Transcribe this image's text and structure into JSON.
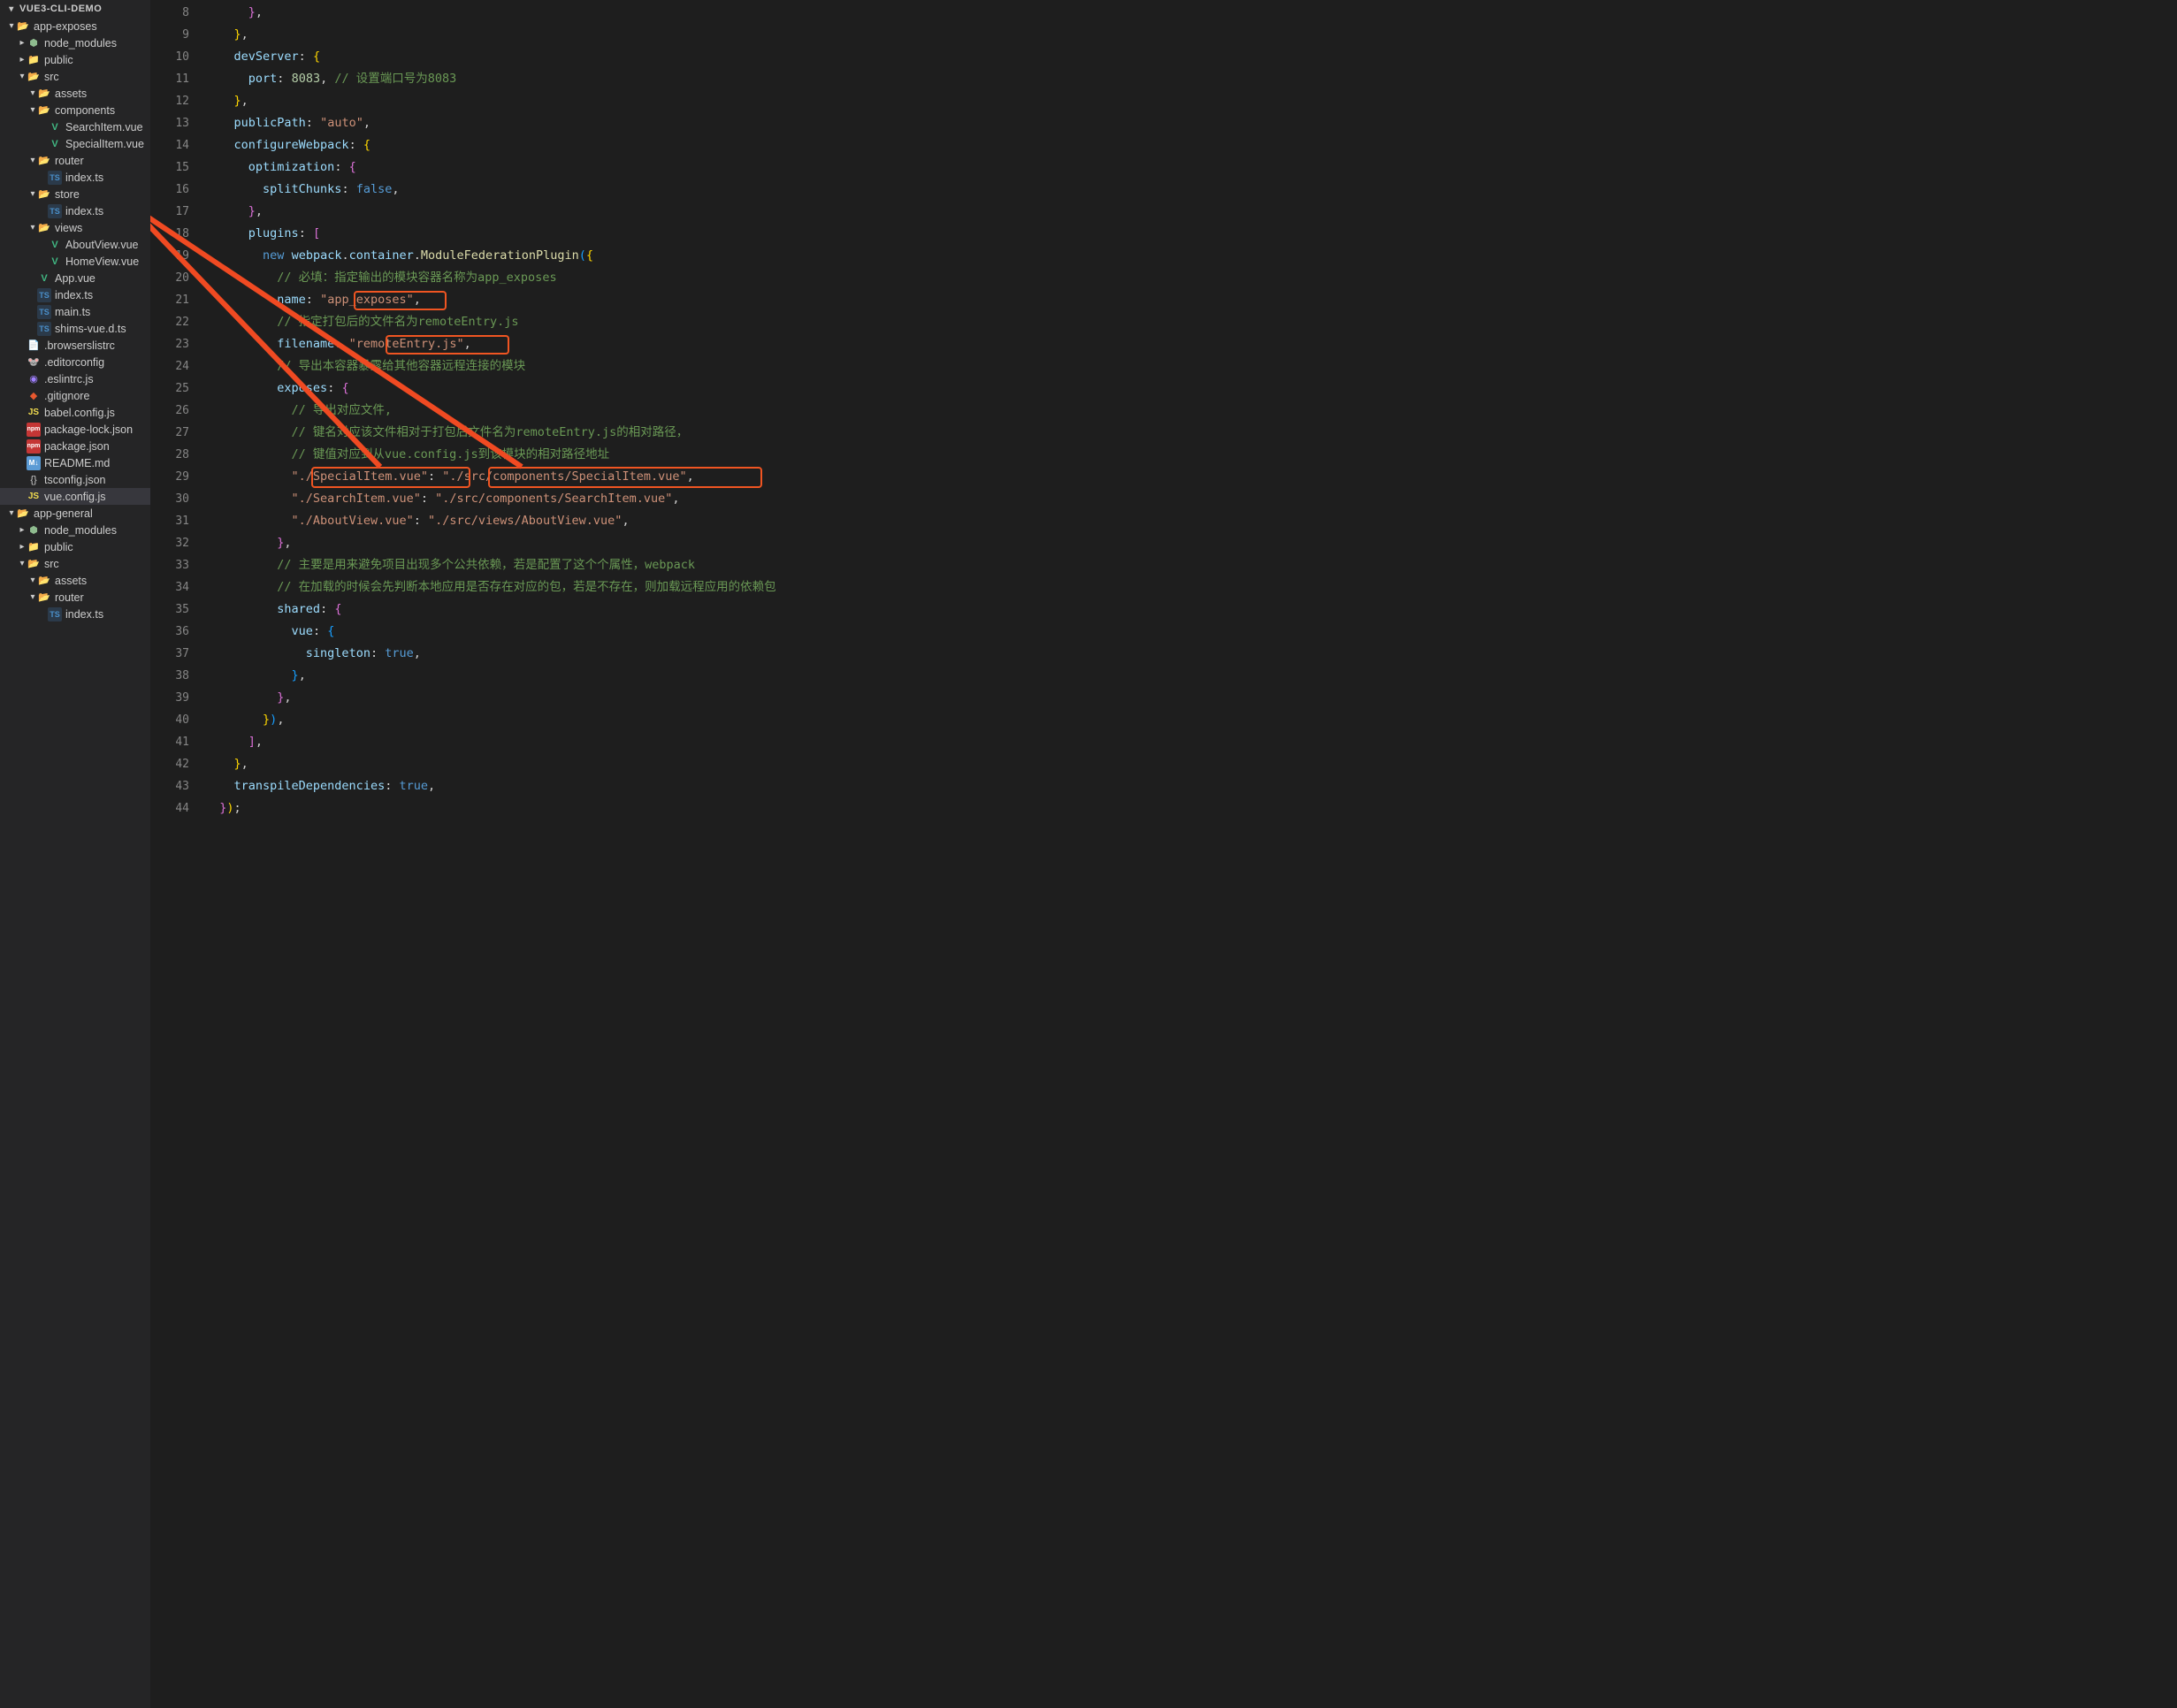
{
  "explorer": {
    "title": "VUE3-CLI-DEMO",
    "tree": [
      {
        "indent": 1,
        "chev": "▾",
        "icon": "folder-open",
        "label": "app-exposes"
      },
      {
        "indent": 2,
        "chev": "▸",
        "icon": "node",
        "label": "node_modules"
      },
      {
        "indent": 2,
        "chev": "▸",
        "icon": "folder",
        "label": "public"
      },
      {
        "indent": 2,
        "chev": "▾",
        "icon": "folder-open",
        "label": "src"
      },
      {
        "indent": 3,
        "chev": "▾",
        "icon": "folder-open",
        "label": "assets"
      },
      {
        "indent": 3,
        "chev": "▾",
        "icon": "folder-open",
        "label": "components"
      },
      {
        "indent": 4,
        "chev": "",
        "icon": "vue",
        "label": "SearchItem.vue"
      },
      {
        "indent": 4,
        "chev": "",
        "icon": "vue",
        "label": "SpecialItem.vue"
      },
      {
        "indent": 3,
        "chev": "▾",
        "icon": "folder-open",
        "label": "router"
      },
      {
        "indent": 4,
        "chev": "",
        "icon": "ts",
        "label": "index.ts"
      },
      {
        "indent": 3,
        "chev": "▾",
        "icon": "folder-open",
        "label": "store"
      },
      {
        "indent": 4,
        "chev": "",
        "icon": "ts",
        "label": "index.ts"
      },
      {
        "indent": 3,
        "chev": "▾",
        "icon": "folder-open",
        "label": "views"
      },
      {
        "indent": 4,
        "chev": "",
        "icon": "vue",
        "label": "AboutView.vue"
      },
      {
        "indent": 4,
        "chev": "",
        "icon": "vue",
        "label": "HomeView.vue"
      },
      {
        "indent": 3,
        "chev": "",
        "icon": "vue",
        "label": "App.vue"
      },
      {
        "indent": 3,
        "chev": "",
        "icon": "ts",
        "label": "index.ts"
      },
      {
        "indent": 3,
        "chev": "",
        "icon": "ts",
        "label": "main.ts"
      },
      {
        "indent": 3,
        "chev": "",
        "icon": "ts",
        "label": "shims-vue.d.ts"
      },
      {
        "indent": 2,
        "chev": "",
        "icon": "browsers",
        "label": ".browserslistrc"
      },
      {
        "indent": 2,
        "chev": "",
        "icon": "editor",
        "label": ".editorconfig"
      },
      {
        "indent": 2,
        "chev": "",
        "icon": "eslint",
        "label": ".eslintrc.js"
      },
      {
        "indent": 2,
        "chev": "",
        "icon": "git",
        "label": ".gitignore"
      },
      {
        "indent": 2,
        "chev": "",
        "icon": "js",
        "label": "babel.config.js"
      },
      {
        "indent": 2,
        "chev": "",
        "icon": "npm",
        "label": "package-lock.json"
      },
      {
        "indent": 2,
        "chev": "",
        "icon": "npm",
        "label": "package.json"
      },
      {
        "indent": 2,
        "chev": "",
        "icon": "md",
        "label": "README.md"
      },
      {
        "indent": 2,
        "chev": "",
        "icon": "json",
        "label": "tsconfig.json"
      },
      {
        "indent": 2,
        "chev": "",
        "icon": "js",
        "label": "vue.config.js",
        "selected": true
      },
      {
        "indent": 1,
        "chev": "▾",
        "icon": "folder-open",
        "label": "app-general"
      },
      {
        "indent": 2,
        "chev": "▸",
        "icon": "node",
        "label": "node_modules"
      },
      {
        "indent": 2,
        "chev": "▸",
        "icon": "folder",
        "label": "public"
      },
      {
        "indent": 2,
        "chev": "▾",
        "icon": "folder-open",
        "label": "src"
      },
      {
        "indent": 3,
        "chev": "▾",
        "icon": "folder-open",
        "label": "assets"
      },
      {
        "indent": 3,
        "chev": "▾",
        "icon": "folder-open",
        "label": "router"
      },
      {
        "indent": 4,
        "chev": "",
        "icon": "ts",
        "label": "index.ts"
      }
    ]
  },
  "editor": {
    "startLine": 8,
    "endLine": 44,
    "lines": [
      {
        "n": 8,
        "tokens": [
          {
            "t": "      ",
            "c": ""
          },
          {
            "t": "}",
            "c": "brace2"
          },
          {
            "t": ",",
            "c": "punc"
          }
        ]
      },
      {
        "n": 9,
        "tokens": [
          {
            "t": "    ",
            "c": ""
          },
          {
            "t": "}",
            "c": "brace"
          },
          {
            "t": ",",
            "c": "punc"
          }
        ]
      },
      {
        "n": 10,
        "tokens": [
          {
            "t": "    ",
            "c": ""
          },
          {
            "t": "devServer",
            "c": "key"
          },
          {
            "t": ": ",
            "c": "punc"
          },
          {
            "t": "{",
            "c": "brace"
          }
        ]
      },
      {
        "n": 11,
        "tokens": [
          {
            "t": "      ",
            "c": ""
          },
          {
            "t": "port",
            "c": "key"
          },
          {
            "t": ": ",
            "c": "punc"
          },
          {
            "t": "8083",
            "c": "num"
          },
          {
            "t": ", ",
            "c": "punc"
          },
          {
            "t": "// 设置端口号为8083",
            "c": "comment"
          }
        ]
      },
      {
        "n": 12,
        "tokens": [
          {
            "t": "    ",
            "c": ""
          },
          {
            "t": "}",
            "c": "brace"
          },
          {
            "t": ",",
            "c": "punc"
          }
        ]
      },
      {
        "n": 13,
        "tokens": [
          {
            "t": "    ",
            "c": ""
          },
          {
            "t": "publicPath",
            "c": "key"
          },
          {
            "t": ": ",
            "c": "punc"
          },
          {
            "t": "\"auto\"",
            "c": "str"
          },
          {
            "t": ",",
            "c": "punc"
          }
        ]
      },
      {
        "n": 14,
        "tokens": [
          {
            "t": "    ",
            "c": ""
          },
          {
            "t": "configureWebpack",
            "c": "key"
          },
          {
            "t": ": ",
            "c": "punc"
          },
          {
            "t": "{",
            "c": "brace"
          }
        ]
      },
      {
        "n": 15,
        "tokens": [
          {
            "t": "      ",
            "c": ""
          },
          {
            "t": "optimization",
            "c": "key"
          },
          {
            "t": ": ",
            "c": "punc"
          },
          {
            "t": "{",
            "c": "brace2"
          }
        ]
      },
      {
        "n": 16,
        "tokens": [
          {
            "t": "        ",
            "c": ""
          },
          {
            "t": "splitChunks",
            "c": "key"
          },
          {
            "t": ": ",
            "c": "punc"
          },
          {
            "t": "false",
            "c": "bool"
          },
          {
            "t": ",",
            "c": "punc"
          }
        ]
      },
      {
        "n": 17,
        "tokens": [
          {
            "t": "      ",
            "c": ""
          },
          {
            "t": "}",
            "c": "brace2"
          },
          {
            "t": ",",
            "c": "punc"
          }
        ]
      },
      {
        "n": 18,
        "tokens": [
          {
            "t": "      ",
            "c": ""
          },
          {
            "t": "plugins",
            "c": "key"
          },
          {
            "t": ": ",
            "c": "punc"
          },
          {
            "t": "[",
            "c": "brace2"
          }
        ]
      },
      {
        "n": 19,
        "tokens": [
          {
            "t": "        ",
            "c": ""
          },
          {
            "t": "new",
            "c": "kw"
          },
          {
            "t": " ",
            "c": ""
          },
          {
            "t": "webpack",
            "c": "var"
          },
          {
            "t": ".",
            "c": "punc"
          },
          {
            "t": "container",
            "c": "var"
          },
          {
            "t": ".",
            "c": "punc"
          },
          {
            "t": "ModuleFederationPlugin",
            "c": "func"
          },
          {
            "t": "(",
            "c": "brace3"
          },
          {
            "t": "{",
            "c": "brace"
          }
        ]
      },
      {
        "n": 20,
        "tokens": [
          {
            "t": "          ",
            "c": ""
          },
          {
            "t": "// 必填：指定输出的模块容器名称为app_exposes",
            "c": "comment"
          }
        ]
      },
      {
        "n": 21,
        "tokens": [
          {
            "t": "          ",
            "c": ""
          },
          {
            "t": "name",
            "c": "key"
          },
          {
            "t": ": ",
            "c": "punc"
          },
          {
            "t": "\"app_exposes\"",
            "c": "str"
          },
          {
            "t": ",",
            "c": "punc"
          }
        ]
      },
      {
        "n": 22,
        "tokens": [
          {
            "t": "          ",
            "c": ""
          },
          {
            "t": "// 指定打包后的文件名为remoteEntry.js",
            "c": "comment"
          }
        ]
      },
      {
        "n": 23,
        "tokens": [
          {
            "t": "          ",
            "c": ""
          },
          {
            "t": "filename",
            "c": "key"
          },
          {
            "t": ": ",
            "c": "punc"
          },
          {
            "t": "\"remoteEntry.js\"",
            "c": "str"
          },
          {
            "t": ",",
            "c": "punc"
          }
        ]
      },
      {
        "n": 24,
        "tokens": [
          {
            "t": "          ",
            "c": ""
          },
          {
            "t": "// 导出本容器暴露给其他容器远程连接的模块",
            "c": "comment"
          }
        ]
      },
      {
        "n": 25,
        "tokens": [
          {
            "t": "          ",
            "c": ""
          },
          {
            "t": "exposes",
            "c": "key"
          },
          {
            "t": ": ",
            "c": "punc"
          },
          {
            "t": "{",
            "c": "brace2"
          }
        ]
      },
      {
        "n": 26,
        "tokens": [
          {
            "t": "            ",
            "c": ""
          },
          {
            "t": "// 导出对应文件,",
            "c": "comment"
          }
        ]
      },
      {
        "n": 27,
        "tokens": [
          {
            "t": "            ",
            "c": ""
          },
          {
            "t": "// 键名对应该文件相对于打包后文件名为remoteEntry.js的相对路径，",
            "c": "comment"
          }
        ]
      },
      {
        "n": 28,
        "tokens": [
          {
            "t": "            ",
            "c": ""
          },
          {
            "t": "// 键值对应到从vue.config.js到该模块的相对路径地址",
            "c": "comment"
          }
        ]
      },
      {
        "n": 29,
        "tokens": [
          {
            "t": "            ",
            "c": ""
          },
          {
            "t": "\"./SpecialItem.vue\"",
            "c": "str"
          },
          {
            "t": ": ",
            "c": "punc"
          },
          {
            "t": "\"./src/components/SpecialItem.vue\"",
            "c": "str"
          },
          {
            "t": ",",
            "c": "punc"
          }
        ]
      },
      {
        "n": 30,
        "tokens": [
          {
            "t": "            ",
            "c": ""
          },
          {
            "t": "\"./SearchItem.vue\"",
            "c": "str"
          },
          {
            "t": ": ",
            "c": "punc"
          },
          {
            "t": "\"./src/components/SearchItem.vue\"",
            "c": "str"
          },
          {
            "t": ",",
            "c": "punc"
          }
        ]
      },
      {
        "n": 31,
        "tokens": [
          {
            "t": "            ",
            "c": ""
          },
          {
            "t": "\"./AboutView.vue\"",
            "c": "str"
          },
          {
            "t": ": ",
            "c": "punc"
          },
          {
            "t": "\"./src/views/AboutView.vue\"",
            "c": "str"
          },
          {
            "t": ",",
            "c": "punc"
          }
        ]
      },
      {
        "n": 32,
        "tokens": [
          {
            "t": "          ",
            "c": ""
          },
          {
            "t": "}",
            "c": "brace2"
          },
          {
            "t": ",",
            "c": "punc"
          }
        ]
      },
      {
        "n": 33,
        "tokens": [
          {
            "t": "          ",
            "c": ""
          },
          {
            "t": "// 主要是用来避免项目出现多个公共依赖，若是配置了这个个属性，webpack",
            "c": "comment"
          }
        ]
      },
      {
        "n": 34,
        "tokens": [
          {
            "t": "          ",
            "c": ""
          },
          {
            "t": "// 在加载的时候会先判断本地应用是否存在对应的包，若是不存在，则加载远程应用的依赖包",
            "c": "comment"
          }
        ]
      },
      {
        "n": 35,
        "tokens": [
          {
            "t": "          ",
            "c": ""
          },
          {
            "t": "shared",
            "c": "key"
          },
          {
            "t": ": ",
            "c": "punc"
          },
          {
            "t": "{",
            "c": "brace2"
          }
        ]
      },
      {
        "n": 36,
        "tokens": [
          {
            "t": "            ",
            "c": ""
          },
          {
            "t": "vue",
            "c": "key"
          },
          {
            "t": ": ",
            "c": "punc"
          },
          {
            "t": "{",
            "c": "brace3"
          }
        ]
      },
      {
        "n": 37,
        "tokens": [
          {
            "t": "              ",
            "c": ""
          },
          {
            "t": "singleton",
            "c": "key"
          },
          {
            "t": ": ",
            "c": "punc"
          },
          {
            "t": "true",
            "c": "bool"
          },
          {
            "t": ",",
            "c": "punc"
          }
        ]
      },
      {
        "n": 38,
        "tokens": [
          {
            "t": "            ",
            "c": ""
          },
          {
            "t": "}",
            "c": "brace3"
          },
          {
            "t": ",",
            "c": "punc"
          }
        ]
      },
      {
        "n": 39,
        "tokens": [
          {
            "t": "          ",
            "c": ""
          },
          {
            "t": "}",
            "c": "brace2"
          },
          {
            "t": ",",
            "c": "punc"
          }
        ]
      },
      {
        "n": 40,
        "tokens": [
          {
            "t": "        ",
            "c": ""
          },
          {
            "t": "}",
            "c": "brace"
          },
          {
            "t": ")",
            "c": "brace3"
          },
          {
            "t": ",",
            "c": "punc"
          }
        ]
      },
      {
        "n": 41,
        "tokens": [
          {
            "t": "      ",
            "c": ""
          },
          {
            "t": "]",
            "c": "brace2"
          },
          {
            "t": ",",
            "c": "punc"
          }
        ]
      },
      {
        "n": 42,
        "tokens": [
          {
            "t": "    ",
            "c": ""
          },
          {
            "t": "}",
            "c": "brace"
          },
          {
            "t": ",",
            "c": "punc"
          }
        ]
      },
      {
        "n": 43,
        "tokens": [
          {
            "t": "    ",
            "c": ""
          },
          {
            "t": "transpileDependencies",
            "c": "key"
          },
          {
            "t": ": ",
            "c": "punc"
          },
          {
            "t": "true",
            "c": "bool"
          },
          {
            "t": ",",
            "c": "punc"
          }
        ]
      },
      {
        "n": 44,
        "tokens": [
          {
            "t": "  ",
            "c": ""
          },
          {
            "t": "}",
            "c": "brace2"
          },
          {
            "t": ")",
            "c": "brace"
          },
          {
            "t": ";",
            "c": "punc"
          }
        ]
      }
    ]
  },
  "annotations": {
    "highlights": [
      {
        "name": "hl-app-exposes",
        "text": "app_exposes"
      },
      {
        "name": "hl-remote-entry",
        "text": "remoteEntry.js"
      },
      {
        "name": "hl-special-key",
        "text": "./SpecialItem.vue"
      },
      {
        "name": "hl-special-val",
        "text": "./src/components/SpecialItem.vue"
      }
    ],
    "arrows": [
      {
        "name": "arrow-key-to-file",
        "from": "hl-special-key",
        "to": "tree SpecialItem.vue"
      },
      {
        "name": "arrow-val-to-file",
        "from": "hl-special-val",
        "to": "tree SpecialItem.vue"
      }
    ]
  }
}
